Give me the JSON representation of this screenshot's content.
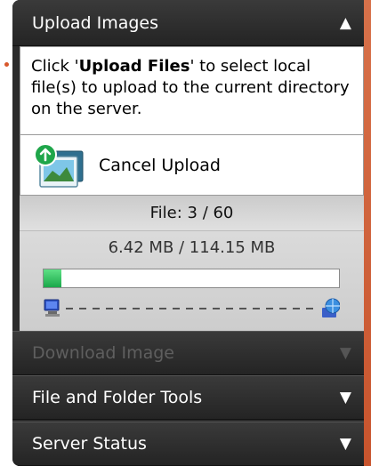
{
  "sections": {
    "upload": {
      "title": "Upload Images",
      "arrow": "▲"
    },
    "download": {
      "title": "Download Image",
      "arrow": "▼"
    },
    "tools": {
      "title": "File and Folder Tools",
      "arrow": "▼"
    },
    "status": {
      "title": "Server Status",
      "arrow": "▼"
    }
  },
  "instructions": {
    "prefix": "Click '",
    "button_name": "Upload Files",
    "suffix": "' to select local file(s) to upload to the current directory on the server."
  },
  "cancel": {
    "label": "Cancel Upload",
    "icon": "upload-images-icon"
  },
  "progress": {
    "file_count": "File: 3 / 60",
    "size_text": "6.42 MB / 114.15 MB",
    "fraction": 0.06
  },
  "colors": {
    "accent": "#d8582c",
    "progress_green": "#22b14c",
    "header_bg": "#2b2b2b"
  }
}
